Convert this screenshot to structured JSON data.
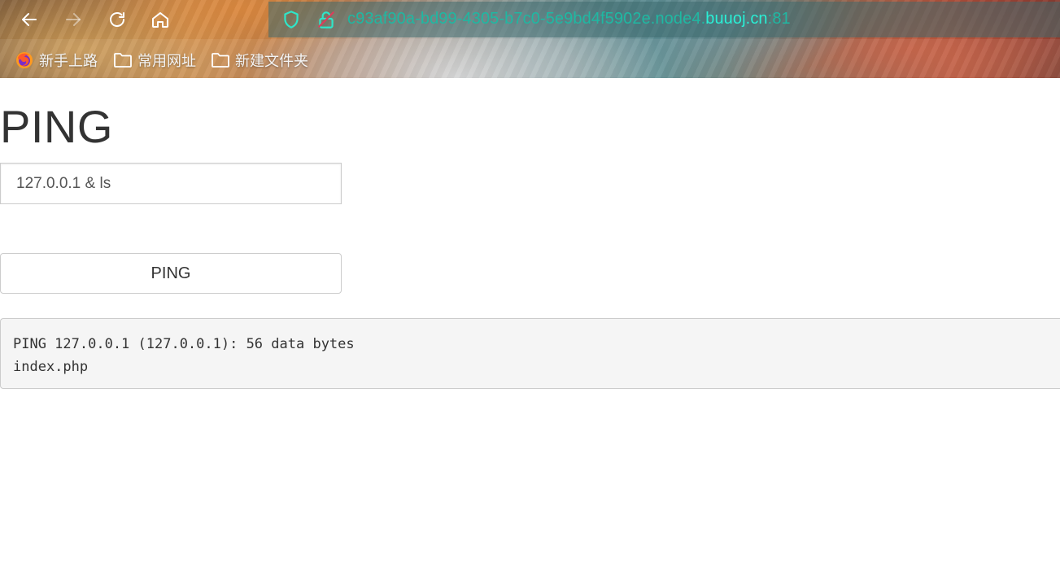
{
  "browser": {
    "url_prefix": "c93af90a-bd99-4305-b7c0-5e9bd4f5902e.node4.",
    "url_host": "buuoj.cn",
    "url_port": ":81",
    "bookmarks": [
      {
        "label": "新手上路",
        "icon": "firefox-icon"
      },
      {
        "label": "常用网址",
        "icon": "folder-icon"
      },
      {
        "label": "新建文件夹",
        "icon": "folder-icon"
      }
    ],
    "colors": {
      "url_text": "#1fb8a2",
      "url_host": "#29f0d6",
      "chrome_icons": "#ffffff"
    }
  },
  "page": {
    "title": "PING",
    "input_value": "127.0.0.1 & ls",
    "button_label": "PING",
    "output_lines": [
      "PING 127.0.0.1 (127.0.0.1): 56 data bytes",
      "index.php"
    ]
  }
}
